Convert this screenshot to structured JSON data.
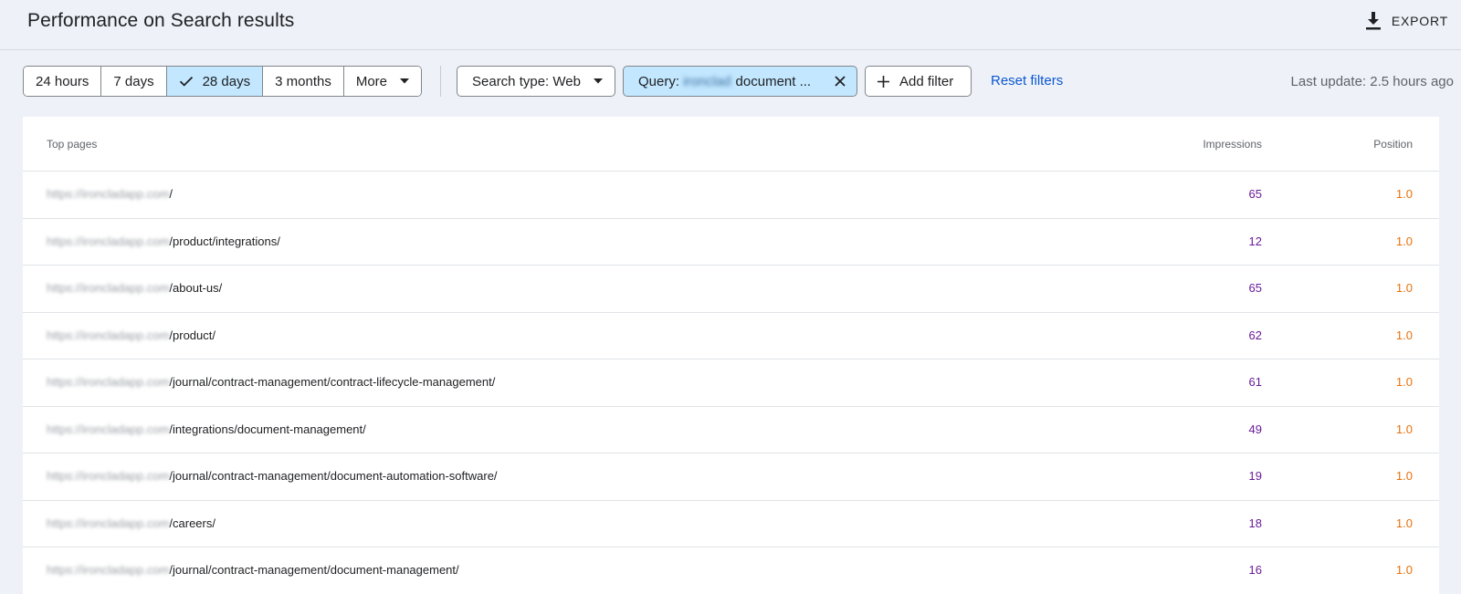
{
  "header": {
    "title": "Performance on Search results",
    "export_label": "EXPORT"
  },
  "filters": {
    "date_ranges": [
      {
        "label": "24 hours",
        "selected": false
      },
      {
        "label": "7 days",
        "selected": false
      },
      {
        "label": "28 days",
        "selected": true
      },
      {
        "label": "3 months",
        "selected": false
      },
      {
        "label": "More",
        "selected": false
      }
    ],
    "search_type": "Search type: Web",
    "query_prefix": "Query:",
    "query_blurred": "ironclad",
    "query_suffix": "document ...",
    "add_filter": "Add filter",
    "reset": "Reset filters",
    "last_update": "Last update: 2.5 hours ago"
  },
  "table": {
    "headers": {
      "page": "Top pages",
      "impressions": "Impressions",
      "position": "Position"
    },
    "host": "https://ironcladapp.com",
    "rows": [
      {
        "path": "/",
        "impressions": "65",
        "position": "1.0"
      },
      {
        "path": "/product/integrations/",
        "impressions": "12",
        "position": "1.0"
      },
      {
        "path": "/about-us/",
        "impressions": "65",
        "position": "1.0"
      },
      {
        "path": "/product/",
        "impressions": "62",
        "position": "1.0"
      },
      {
        "path": "/journal/contract-management/contract-lifecycle-management/",
        "impressions": "61",
        "position": "1.0"
      },
      {
        "path": "/integrations/document-management/",
        "impressions": "49",
        "position": "1.0"
      },
      {
        "path": "/journal/contract-management/document-automation-software/",
        "impressions": "19",
        "position": "1.0"
      },
      {
        "path": "/careers/",
        "impressions": "18",
        "position": "1.0"
      },
      {
        "path": "/journal/contract-management/document-management/",
        "impressions": "16",
        "position": "1.0"
      }
    ]
  },
  "colors": {
    "accent": "#0b57d0",
    "selected_chip": "#c2e7ff",
    "impressions": "#6a1b9a",
    "position": "#e8710a"
  },
  "icons": [
    "download-icon",
    "check-icon",
    "caret-down-icon",
    "close-icon",
    "plus-icon"
  ]
}
